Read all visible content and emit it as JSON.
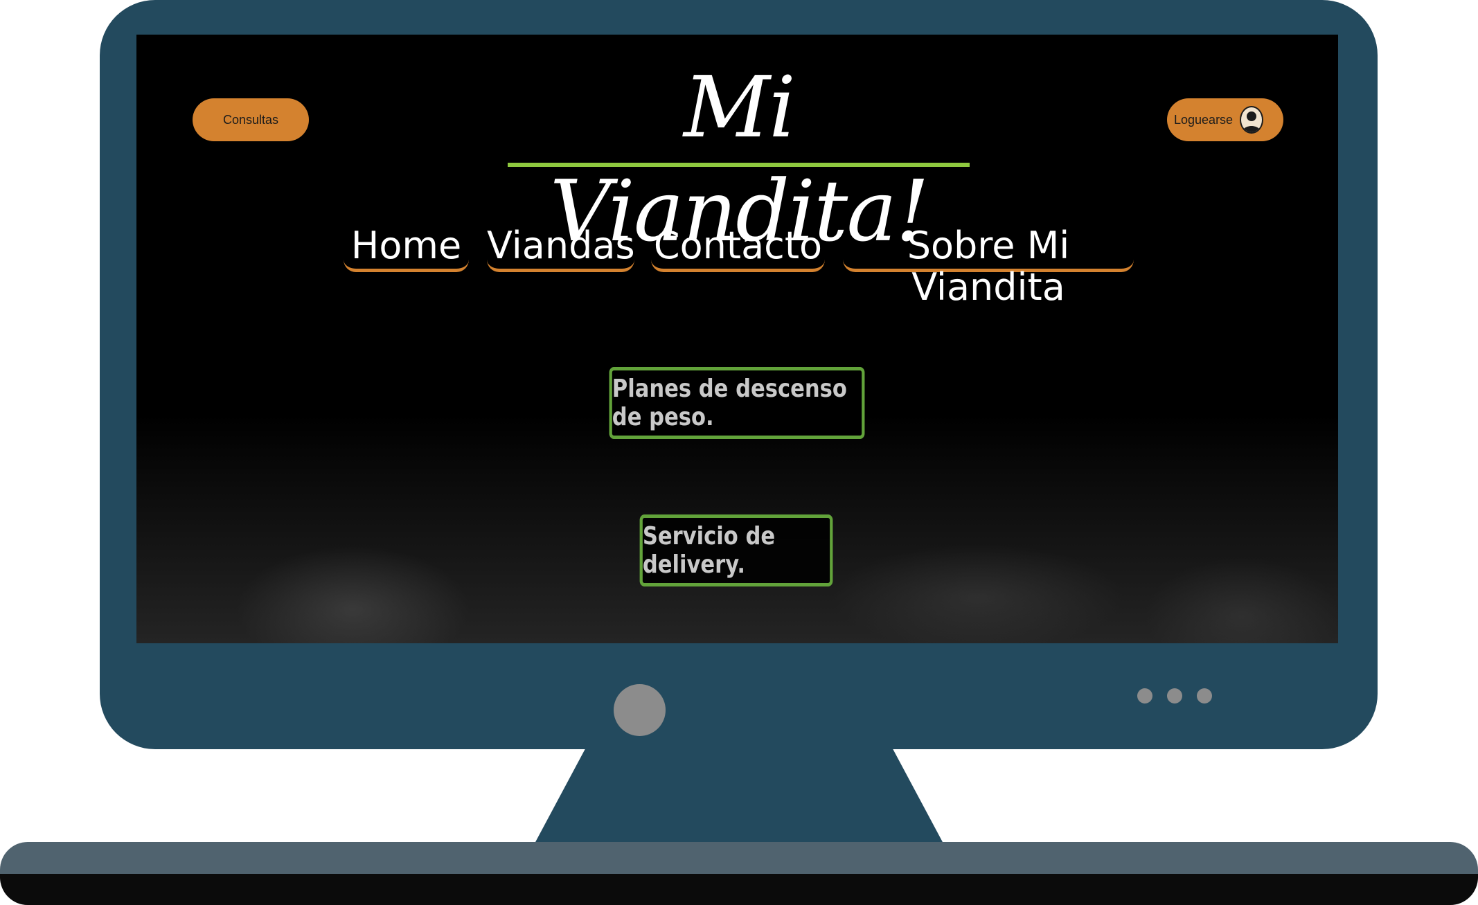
{
  "site": {
    "logo_text": "Mi Viandita!",
    "consultas_label": "Consultas",
    "login_label": "Loguearse",
    "login_icon": "user-silhouette-icon"
  },
  "nav": {
    "items": [
      {
        "label": "Home"
      },
      {
        "label": "Viandas"
      },
      {
        "label": "Contacto"
      },
      {
        "label": "Sobre Mi Viandita"
      }
    ]
  },
  "features": [
    {
      "label": "Planes de descenso de peso."
    },
    {
      "label": "Servicio de delivery."
    }
  ],
  "colors": {
    "accent_orange": "#d4822f",
    "accent_green": "#8fc93f",
    "feature_border": "#62a33a",
    "monitor": "#234a5e",
    "screen_bg": "#000000"
  }
}
